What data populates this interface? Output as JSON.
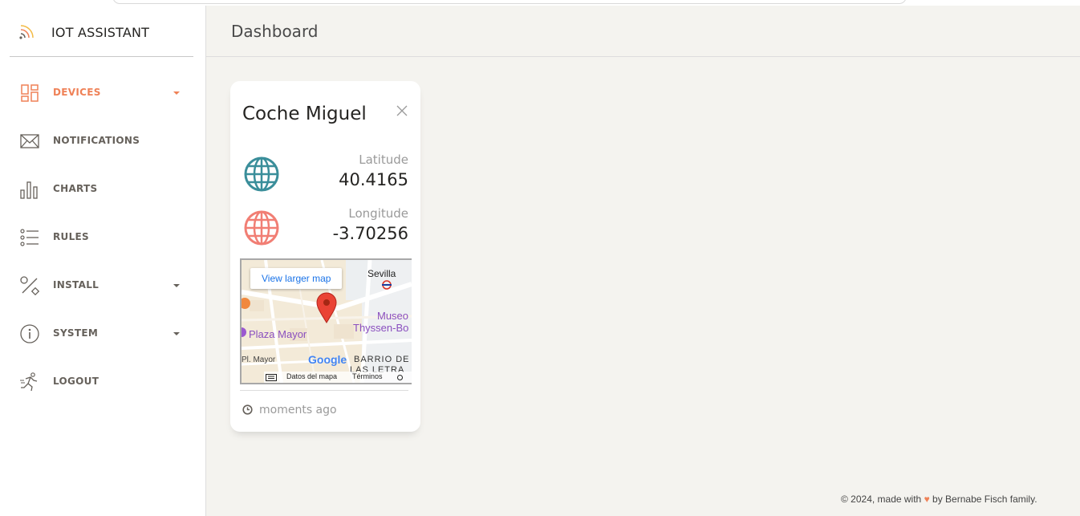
{
  "sidebar": {
    "brand": "IOT ASSISTANT",
    "items": [
      {
        "label": "DEVICES",
        "icon": "dashboard-grid-icon",
        "active": true,
        "has_caret": true
      },
      {
        "label": "NOTIFICATIONS",
        "icon": "envelope-icon",
        "active": false,
        "has_caret": false
      },
      {
        "label": "CHARTS",
        "icon": "bar-chart-icon",
        "active": false,
        "has_caret": false
      },
      {
        "label": "RULES",
        "icon": "list-icon",
        "active": false,
        "has_caret": false
      },
      {
        "label": "INSTALL",
        "icon": "tools-icon",
        "active": false,
        "has_caret": true
      },
      {
        "label": "SYSTEM",
        "icon": "info-icon",
        "active": false,
        "has_caret": true
      },
      {
        "label": "LOGOUT",
        "icon": "runner-icon",
        "active": false,
        "has_caret": false
      }
    ]
  },
  "header": {
    "title": "Dashboard"
  },
  "card": {
    "title": "Coche Miguel",
    "latitude_label": "Latitude",
    "latitude_value": "40.4165",
    "longitude_label": "Longitude",
    "longitude_value": "-3.70256",
    "footer_time": "moments ago",
    "map": {
      "view_larger": "View larger map",
      "labels": {
        "sevilla": "Sevilla",
        "museo_1": "Museo",
        "museo_2": "Thyssen-Bo",
        "plaza": "Plaza Mayor",
        "pl_mayor": "Pl. Mayor",
        "barrio_1": "BARRIO DE",
        "barrio_2": "LAS LETRA",
        "google": "Google",
        "datos": "Datos del mapa",
        "terminos": "Términos"
      }
    }
  },
  "footer": {
    "pre": "© 2024, made with",
    "heart": "♥",
    "post": "by Bernabe Fisch family."
  },
  "colors": {
    "accent": "#ef8157",
    "globe_teal": "#3a8e9a",
    "globe_red": "#f17e74",
    "map_pin": "#ea4335"
  }
}
